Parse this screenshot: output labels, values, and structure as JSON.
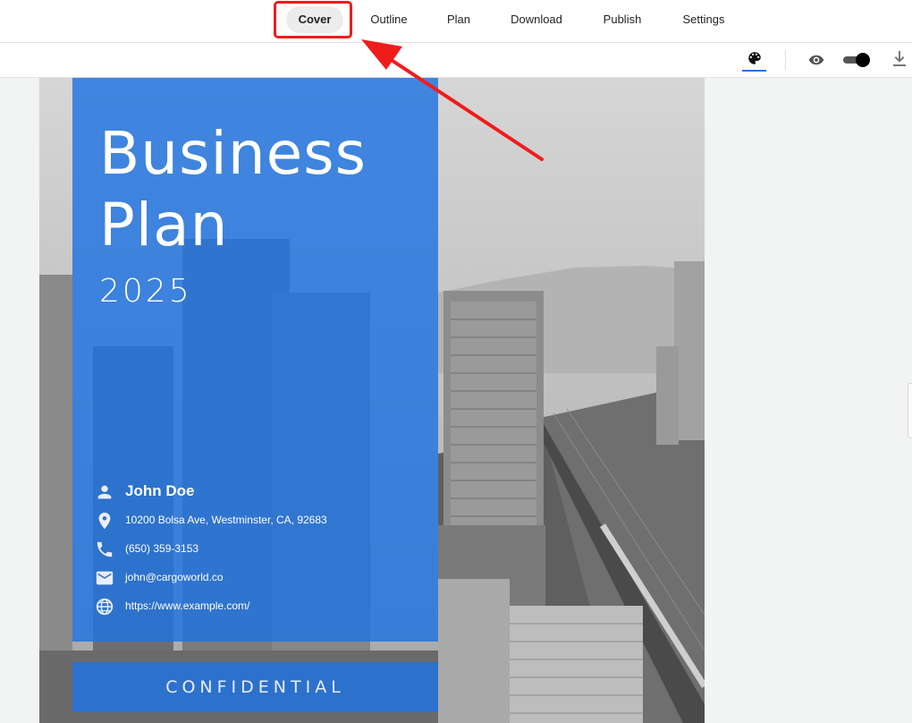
{
  "nav": {
    "items": [
      {
        "label": "Cover",
        "active": true
      },
      {
        "label": "Outline",
        "active": false
      },
      {
        "label": "Plan",
        "active": false
      },
      {
        "label": "Download",
        "active": false
      },
      {
        "label": "Publish",
        "active": false
      },
      {
        "label": "Settings",
        "active": false
      }
    ]
  },
  "toolbar": {
    "icons": [
      "palette-icon",
      "eye-icon",
      "toggle-switch",
      "download-icon"
    ],
    "accent": "#1a73e8"
  },
  "cover": {
    "title": "Business\nPlan",
    "year": "2025",
    "name": "John Doe",
    "address": "10200 Bolsa Ave, Westminster, CA, 92683",
    "phone": "(650) 359-3153",
    "email": "john@cargoworld.co",
    "website": "https://www.example.com/",
    "footer": "CONFIDENTIAL",
    "panel_color": "#1e73e1"
  },
  "annotation": {
    "highlight_color": "#ef1c1c"
  }
}
